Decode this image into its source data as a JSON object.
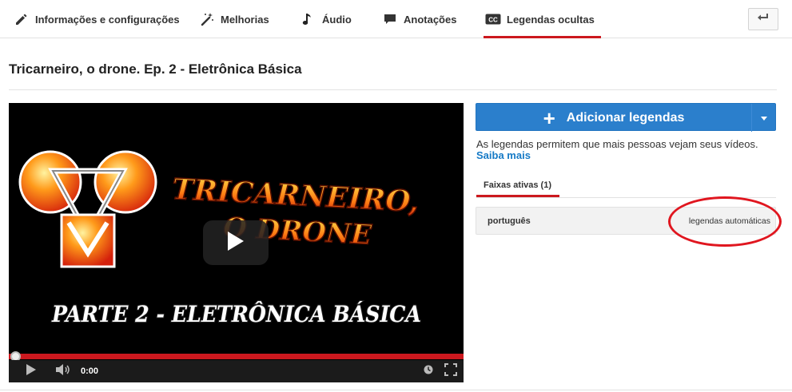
{
  "tabs": [
    {
      "label": "Informações e configurações",
      "icon": "pencil-icon"
    },
    {
      "label": "Melhorias",
      "icon": "magic-wand-icon"
    },
    {
      "label": "Áudio",
      "icon": "music-note-icon"
    },
    {
      "label": "Anotações",
      "icon": "speech-bubble-icon"
    },
    {
      "label": "Legendas ocultas",
      "icon": "cc-icon",
      "active": true
    }
  ],
  "back_button": {
    "icon": "back-arrow-icon"
  },
  "video": {
    "title": "Tricarneiro, o drone. Ep. 2 - Eletrônica Básica",
    "thumbnail_lines": [
      "TRICARNEIRO,",
      "O DRONE",
      "PARTE 2 - ELETRÔNICA BÁSICA"
    ],
    "current_time": "0:00",
    "progress": 0.0
  },
  "captions": {
    "add_button_label": "Adicionar legendas",
    "description": "As legendas permitem que mais pessoas vejam seus vídeos.",
    "learn_more": "Saiba mais",
    "active_tracks_tab": "Faixas ativas (1)",
    "tracks": [
      {
        "language": "português",
        "type": "legendas automáticas"
      }
    ]
  },
  "colors": {
    "accent_red": "#cc181e",
    "primary_blue": "#2b7fcc",
    "link_blue": "#167ac6",
    "annotation_red": "#e0161f"
  }
}
